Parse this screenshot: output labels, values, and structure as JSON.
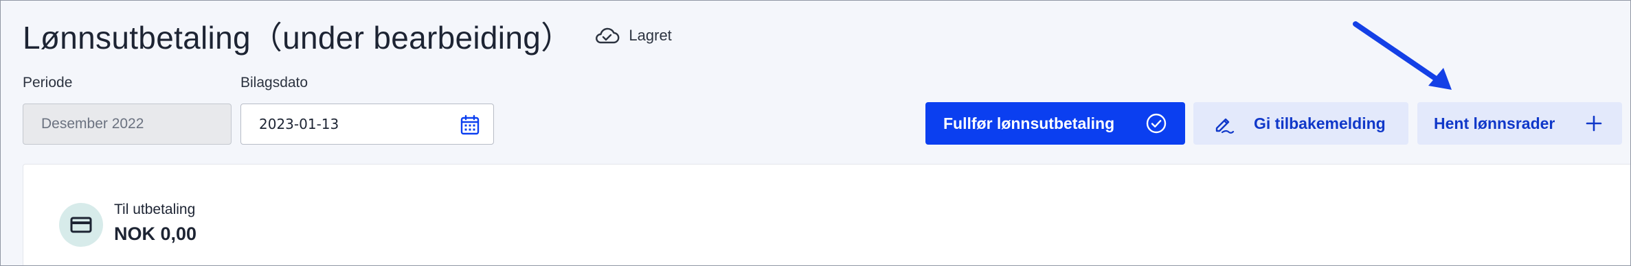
{
  "header": {
    "title": "Lønnsutbetaling（under bearbeiding）",
    "saved_status": "Lagret",
    "saved_icon": "cloud-check-icon"
  },
  "form": {
    "period": {
      "label": "Periode",
      "value": "Desember 2022"
    },
    "voucher_date": {
      "label": "Bilagsdato",
      "value": "2023-01-13",
      "icon": "calendar-icon"
    }
  },
  "actions": {
    "complete": {
      "label": "Fullfør lønnsutbetaling",
      "icon": "check-circle-icon"
    },
    "feedback": {
      "label": "Gi tilbakemelding",
      "icon": "pencil-icon"
    },
    "fetch_rows": {
      "label": "Hent lønnsrader",
      "icon": "plus-icon"
    }
  },
  "summary": {
    "label": "Til utbetaling",
    "amount": "NOK 0,00",
    "icon": "credit-card-icon"
  },
  "colors": {
    "primary": "#0b3ff0",
    "secondary_bg": "#e3e9fb",
    "annotation_arrow": "#1440e6"
  }
}
